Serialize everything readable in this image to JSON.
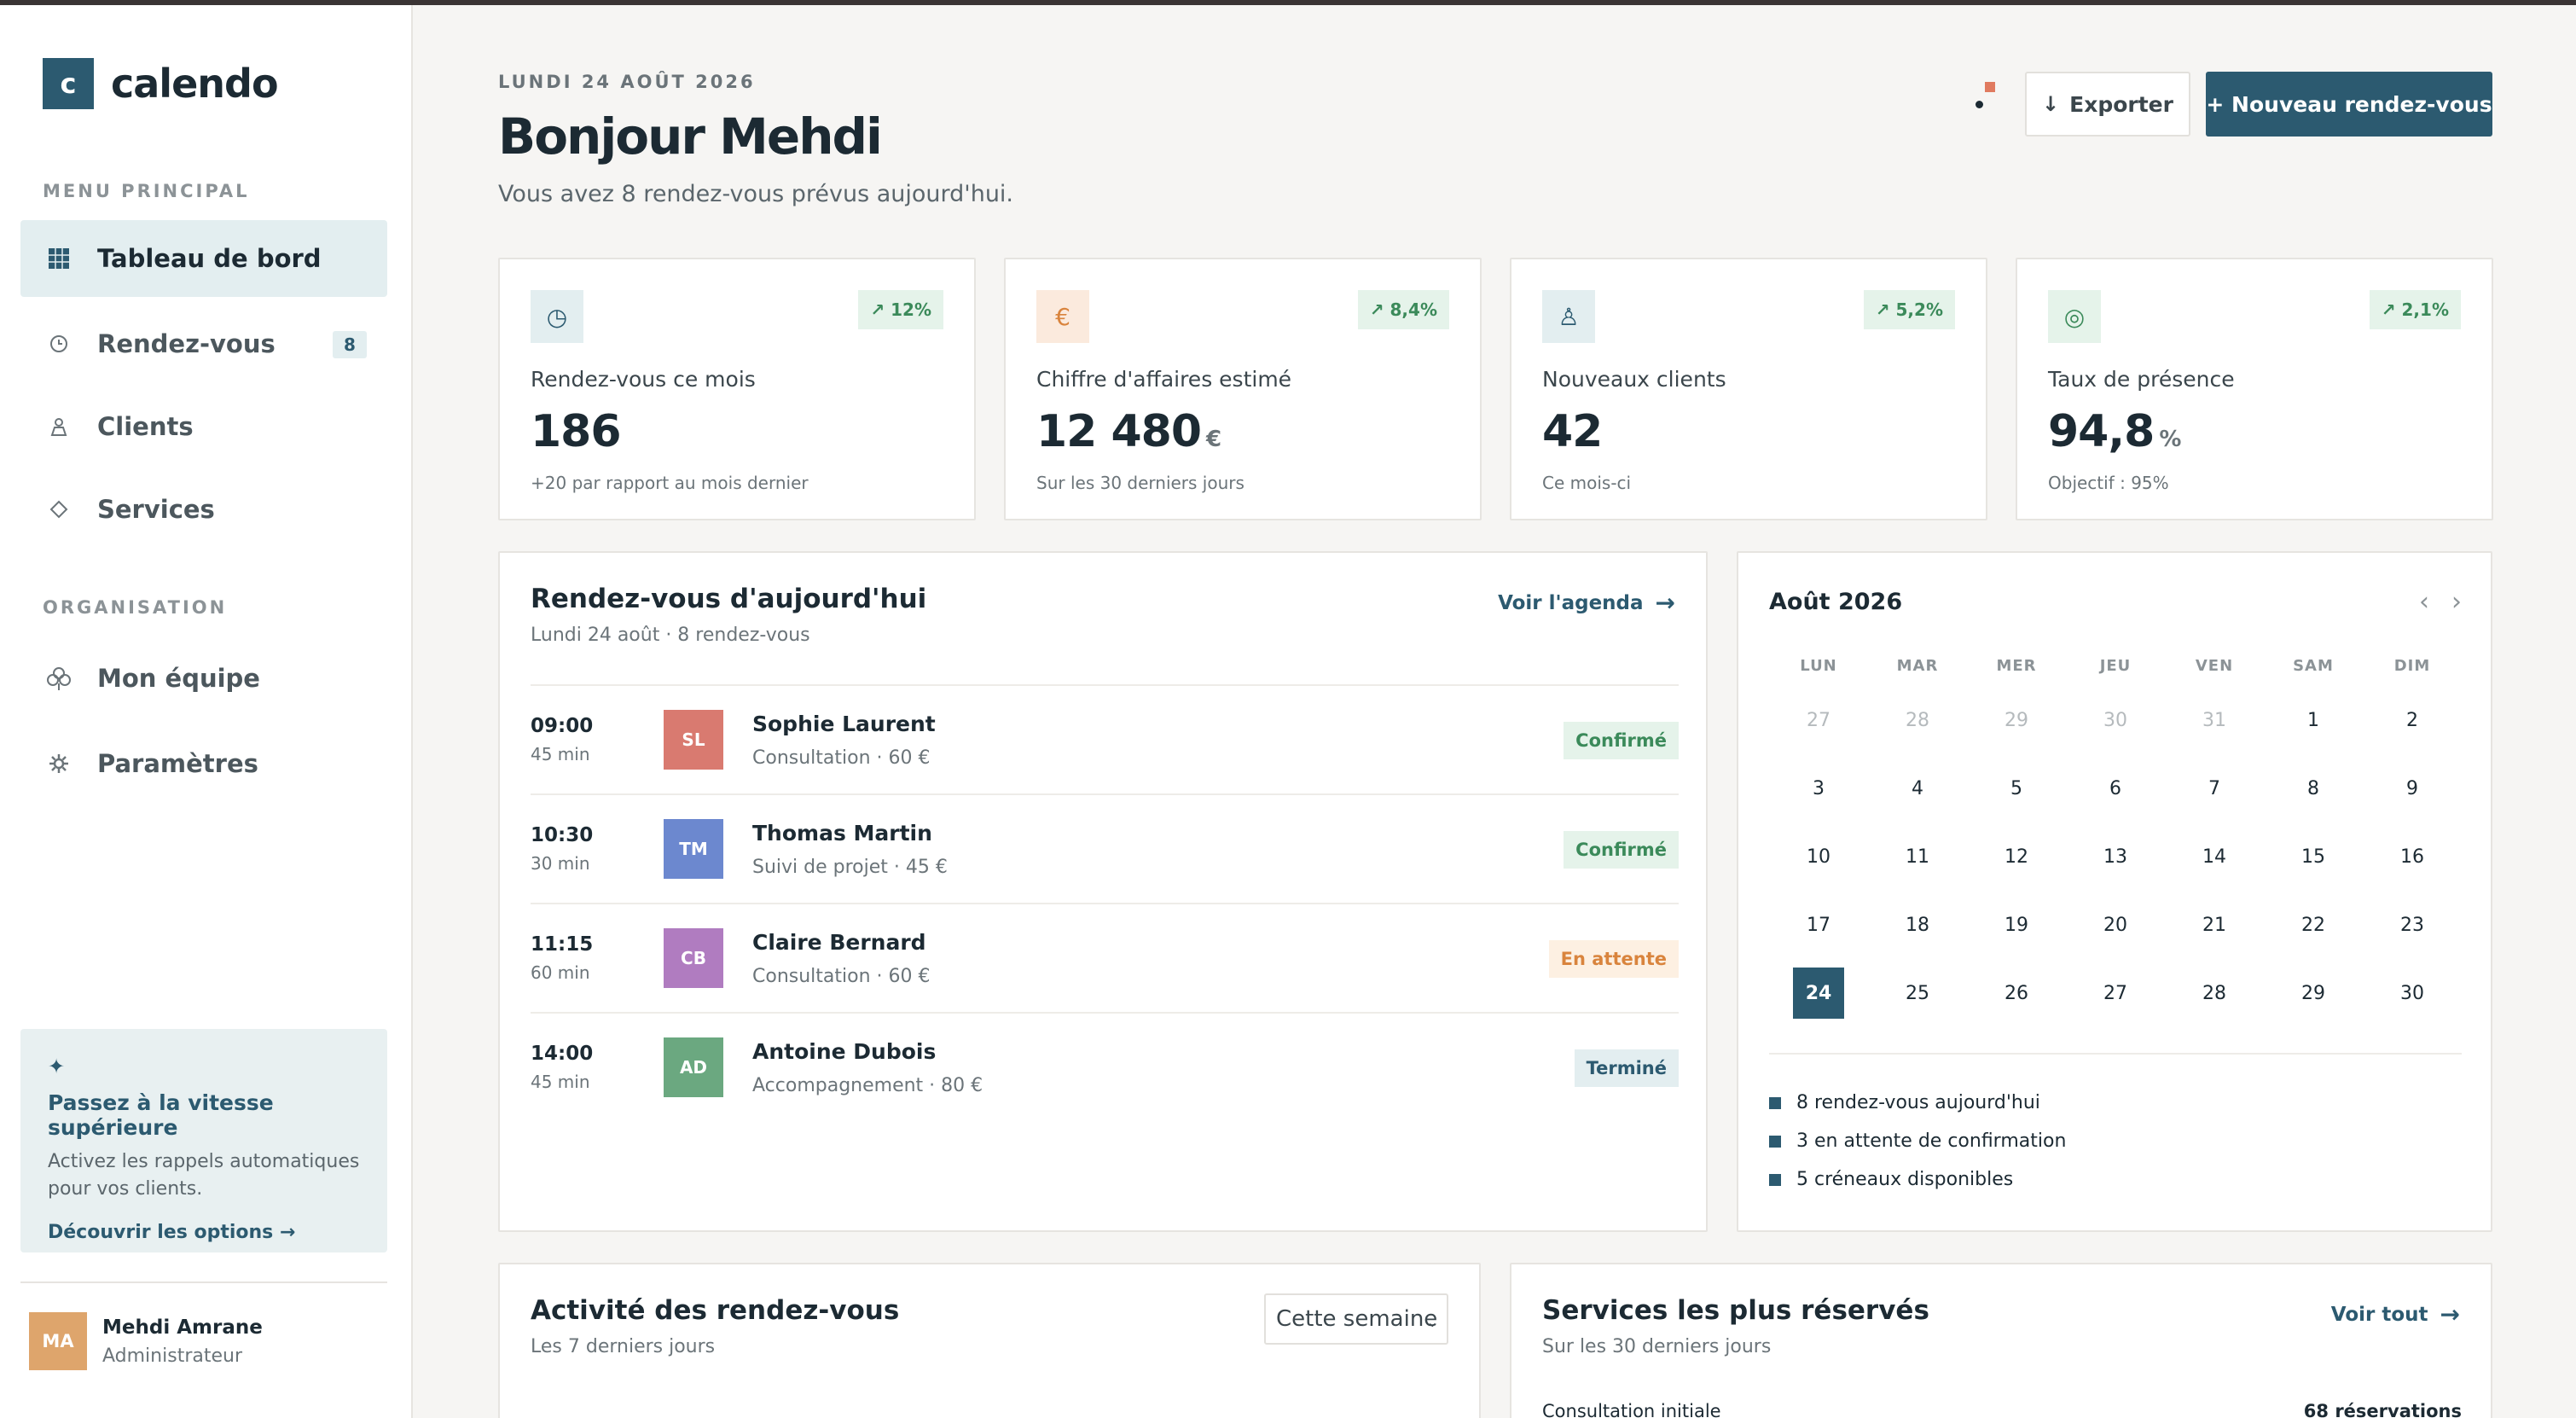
{
  "brand": {
    "logo_letter": "c",
    "name": "calendo"
  },
  "sidebar": {
    "section_main": "MENU PRINCIPAL",
    "section_org": "ORGANISATION",
    "items": [
      {
        "label": "Tableau de bord",
        "icon": "grid-icon",
        "active": true
      },
      {
        "label": "Rendez-vous",
        "icon": "clock-icon",
        "badge": "8"
      },
      {
        "label": "Clients",
        "icon": "person-icon"
      },
      {
        "label": "Services",
        "icon": "diamond-icon"
      },
      {
        "label": "Mon équipe",
        "icon": "team-icon"
      },
      {
        "label": "Paramètres",
        "icon": "gear-icon"
      }
    ],
    "promo": {
      "icon": "✦",
      "title": "Passez à la vitesse supérieure",
      "text": "Activez les rappels automatiques pour vos clients.",
      "link": "Découvrir les options →"
    },
    "user": {
      "initials": "MA",
      "name": "Mehdi Amrane",
      "role": "Administrateur"
    }
  },
  "header": {
    "date": "LUNDI 24 AOÛT 2026",
    "greeting": "Bonjour Mehdi",
    "subtitle": "Vous avez 8 rendez-vous prévus aujourd'hui.",
    "export_label": "Exporter",
    "new_label": "+ Nouveau rendez-vous"
  },
  "kpis": [
    {
      "label": "Rendez-vous ce mois",
      "value": "186",
      "unit": "",
      "trend": "↗ 12%",
      "note": "+20 par rapport au mois dernier",
      "icon": "◷",
      "icon_bg": "#e3eef0",
      "icon_color": "#2c5a70"
    },
    {
      "label": "Chiffre d'affaires estimé",
      "value": "12 480",
      "unit": "€",
      "trend": "↗ 8,4%",
      "note": "Sur les 30 derniers jours",
      "icon": "€",
      "icon_bg": "#fbeadd",
      "icon_color": "#d9843d"
    },
    {
      "label": "Nouveaux clients",
      "value": "42",
      "unit": "",
      "trend": "↗ 5,2%",
      "note": "Ce mois-ci",
      "icon": "♙",
      "icon_bg": "#e3eef0",
      "icon_color": "#2c5a70"
    },
    {
      "label": "Taux de présence",
      "value": "94,8",
      "unit": "%",
      "trend": "↗ 2,1%",
      "note": "Objectif : 95%",
      "icon": "◎",
      "icon_bg": "#e5f3ea",
      "icon_color": "#3b8a5a"
    }
  ],
  "today": {
    "title": "Rendez-vous d'aujourd'hui",
    "subtitle": "Lundi 24 août · 8 rendez-vous",
    "link": "Voir l'agenda",
    "rows": [
      {
        "time": "09:00",
        "duration": "45 min",
        "initials": "SL",
        "color": "#d97a70",
        "name": "Sophie Laurent",
        "detail": "Consultation · 60 €",
        "status": "Confirmé",
        "status_bg": "#e5f3ea",
        "status_color": "#3b8a5a"
      },
      {
        "time": "10:30",
        "duration": "30 min",
        "initials": "TM",
        "color": "#6c88cf",
        "name": "Thomas Martin",
        "detail": "Suivi de projet · 45 €",
        "status": "Confirmé",
        "status_bg": "#e5f3ea",
        "status_color": "#3b8a5a"
      },
      {
        "time": "11:15",
        "duration": "60 min",
        "initials": "CB",
        "color": "#b07cc0",
        "name": "Claire Bernard",
        "detail": "Consultation · 60 €",
        "status": "En attente",
        "status_bg": "#fdf0e2",
        "status_color": "#d9843d"
      },
      {
        "time": "14:00",
        "duration": "45 min",
        "initials": "AD",
        "color": "#6ba880",
        "name": "Antoine Dubois",
        "detail": "Accompagnement · 80 €",
        "status": "Terminé",
        "status_bg": "#e3eef0",
        "status_color": "#2c5a70"
      }
    ]
  },
  "calendar": {
    "title": "Août 2026",
    "prev": "‹",
    "next": "›",
    "weekdays": [
      "LUN",
      "MAR",
      "MER",
      "JEU",
      "VEN",
      "SAM",
      "DIM"
    ],
    "weeks": [
      [
        "27",
        "28",
        "29",
        "30",
        "31",
        "1",
        "2"
      ],
      [
        "3",
        "4",
        "5",
        "6",
        "7",
        "8",
        "9"
      ],
      [
        "10",
        "11",
        "12",
        "13",
        "14",
        "15",
        "16"
      ],
      [
        "17",
        "18",
        "19",
        "20",
        "21",
        "22",
        "23"
      ],
      [
        "24",
        "25",
        "26",
        "27",
        "28",
        "29",
        "30"
      ]
    ],
    "muted_first_week_count": 5,
    "today": "24",
    "legend": [
      "8 rendez-vous aujourd'hui",
      "3 en attente de confirmation",
      "5 créneaux disponibles"
    ]
  },
  "activity": {
    "title": "Activité des rendez-vous",
    "subtitle": "Les 7 derniers jours",
    "select_value": "Cette semaine"
  },
  "services": {
    "title": "Services les plus réservés",
    "subtitle": "Sur les 30 derniers jours",
    "link": "Voir tout",
    "rows": [
      {
        "name": "Consultation initiale",
        "count": "68 réservations"
      }
    ]
  },
  "colors": {
    "primary": "#2c5a70",
    "accent": "#e07a5f",
    "success": "#3b8a5a",
    "warning": "#d9843d"
  }
}
